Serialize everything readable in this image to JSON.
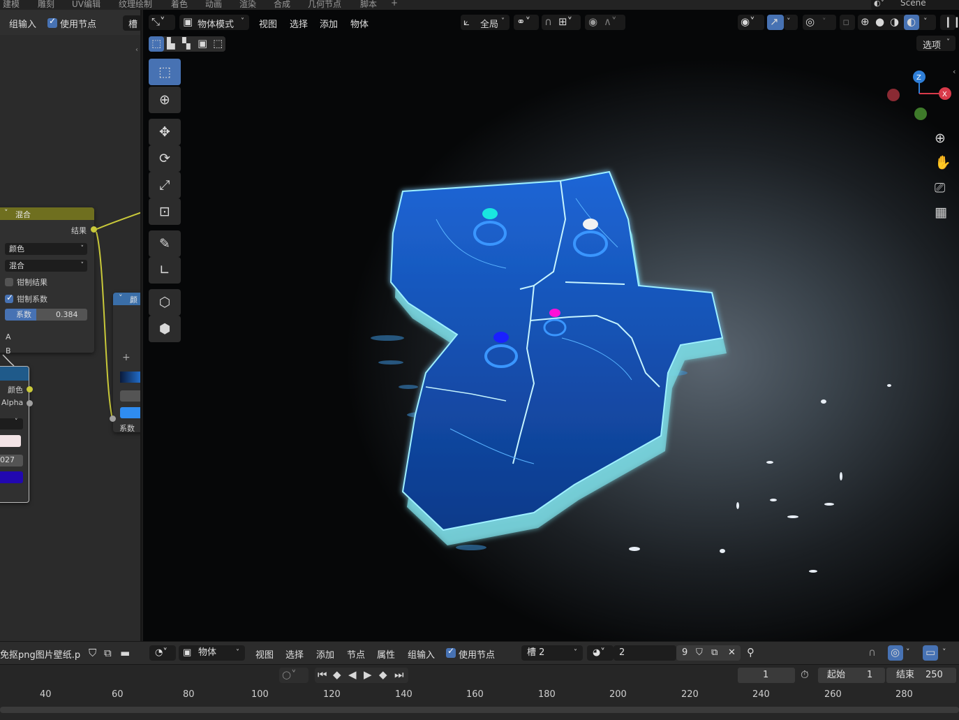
{
  "workspace_tabs": [
    "建模",
    "雕刻",
    "UV编辑",
    "纹理绘制",
    "着色",
    "动画",
    "渲染",
    "合成",
    "几何节点",
    "脚本",
    "+"
  ],
  "scene_name": "Scene",
  "node_editor": {
    "header": {
      "group_input": "组输入",
      "use_nodes": "使用节点",
      "slot": "槽"
    },
    "mix_node": {
      "title": "混合",
      "output": "结果",
      "data_type": "颜色",
      "blend_mode": "混合",
      "clamp_result": "钳制结果",
      "clamp_factor": "钳制系数",
      "factor_label": "系数",
      "factor_value": "0.384",
      "input_a": "A",
      "input_b": "B"
    },
    "color_node": {
      "title_partial": "颜",
      "factor_label": "系数"
    },
    "image_node": {
      "color_out": "颜色",
      "alpha_out": "Alpha",
      "value_partial": "027"
    }
  },
  "viewport": {
    "header": {
      "mode": "物体模式",
      "menus": [
        "视图",
        "选择",
        "添加",
        "物体"
      ],
      "transform_orientation": "全局",
      "options": "选项"
    },
    "gizmo": {
      "z": "Z",
      "x": "X"
    },
    "colors": {
      "accent": "#4772b3",
      "map_glow": "#2a8cff",
      "pin_cyan": "#19e6e0",
      "pin_white": "#f2f2f2",
      "pin_magenta": "#ff10d8",
      "pin_blue": "#1a20ff"
    }
  },
  "bottom_header": {
    "image_name": "免抠png图片壁纸.p",
    "context": "物体",
    "menus": [
      "视图",
      "选择",
      "添加",
      "节点",
      "属性",
      "组输入"
    ],
    "use_nodes": "使用节点",
    "slot": "槽 2",
    "material_users": "2",
    "count": "9"
  },
  "timeline": {
    "current_frame": "1",
    "start_label": "起始",
    "start": "1",
    "end_label": "结束",
    "end": "250",
    "ticks": [
      "40",
      "60",
      "80",
      "100",
      "120",
      "140",
      "160",
      "180",
      "200",
      "220",
      "240",
      "260",
      "280"
    ]
  }
}
